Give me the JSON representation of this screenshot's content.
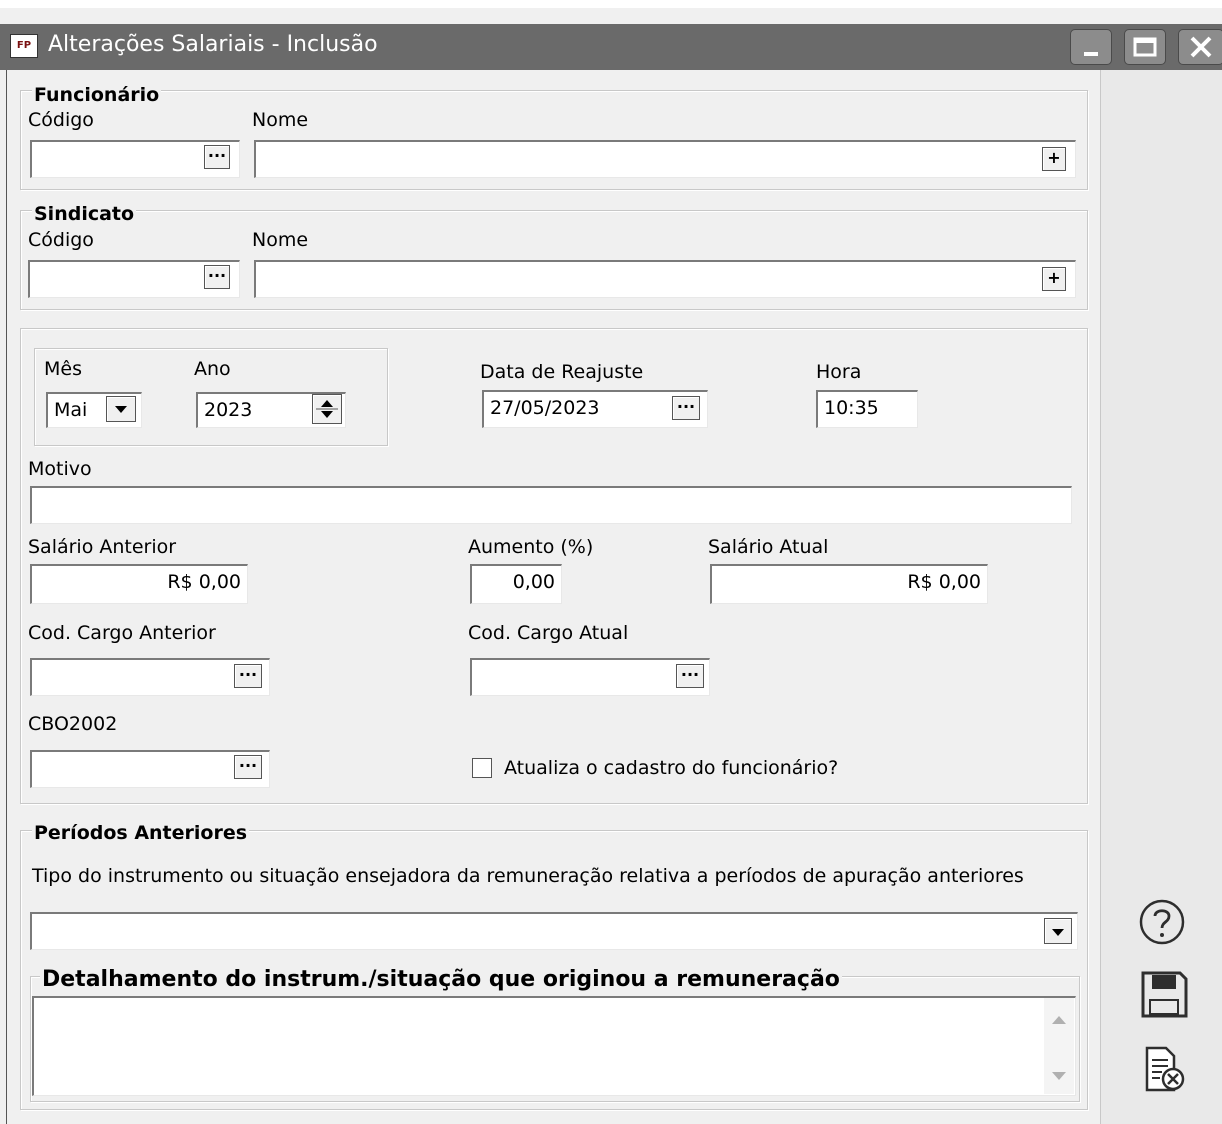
{
  "window": {
    "icon_text": "FP",
    "title": "Alterações Salariais - Inclusão"
  },
  "funcionario": {
    "legend": "Funcionário",
    "codigo_label": "Código",
    "nome_label": "Nome",
    "codigo_value": "",
    "nome_value": "",
    "browse_glyph": "···",
    "add_glyph": "+"
  },
  "sindicato": {
    "legend": "Sindicato",
    "codigo_label": "Código",
    "nome_label": "Nome",
    "codigo_value": "",
    "nome_value": "",
    "browse_glyph": "···",
    "add_glyph": "+"
  },
  "periodo": {
    "mes_label": "Mês",
    "mes_value": "Mai",
    "ano_label": "Ano",
    "ano_value": "2023",
    "data_label": "Data de Reajuste",
    "data_value": "27/05/2023",
    "hora_label": "Hora",
    "hora_value": "10:35"
  },
  "motivo": {
    "label": "Motivo",
    "value": ""
  },
  "salario": {
    "anterior_label": "Salário Anterior",
    "anterior_value": "R$ 0,00",
    "aumento_label": "Aumento (%)",
    "aumento_value": "0,00",
    "atual_label": "Salário Atual",
    "atual_value": "R$ 0,00"
  },
  "cargo": {
    "anterior_label": "Cod. Cargo Anterior",
    "atual_label": "Cod. Cargo Atual",
    "anterior_value": "",
    "atual_value": ""
  },
  "cbo": {
    "label": "CBO2002",
    "value": ""
  },
  "atualiza": {
    "label": "Atualiza o cadastro do funcionário?",
    "checked": false
  },
  "periodos_anteriores": {
    "legend": "Períodos Anteriores",
    "tipo_label": "Tipo do instrumento ou situação ensejadora da remuneração relativa a períodos de apuração anteriores",
    "tipo_value": "",
    "detalhamento_legend": "Detalhamento do instrum./situação que originou a remuneração",
    "detalhamento_value": ""
  },
  "icons": {
    "help": "help-circle-icon",
    "save": "floppy-disk-icon",
    "cancel": "document-cancel-icon"
  },
  "colors": {
    "titlebar": "#6a6a6a",
    "panel": "#f0f0f0",
    "side_panel": "#e9e9e9"
  }
}
